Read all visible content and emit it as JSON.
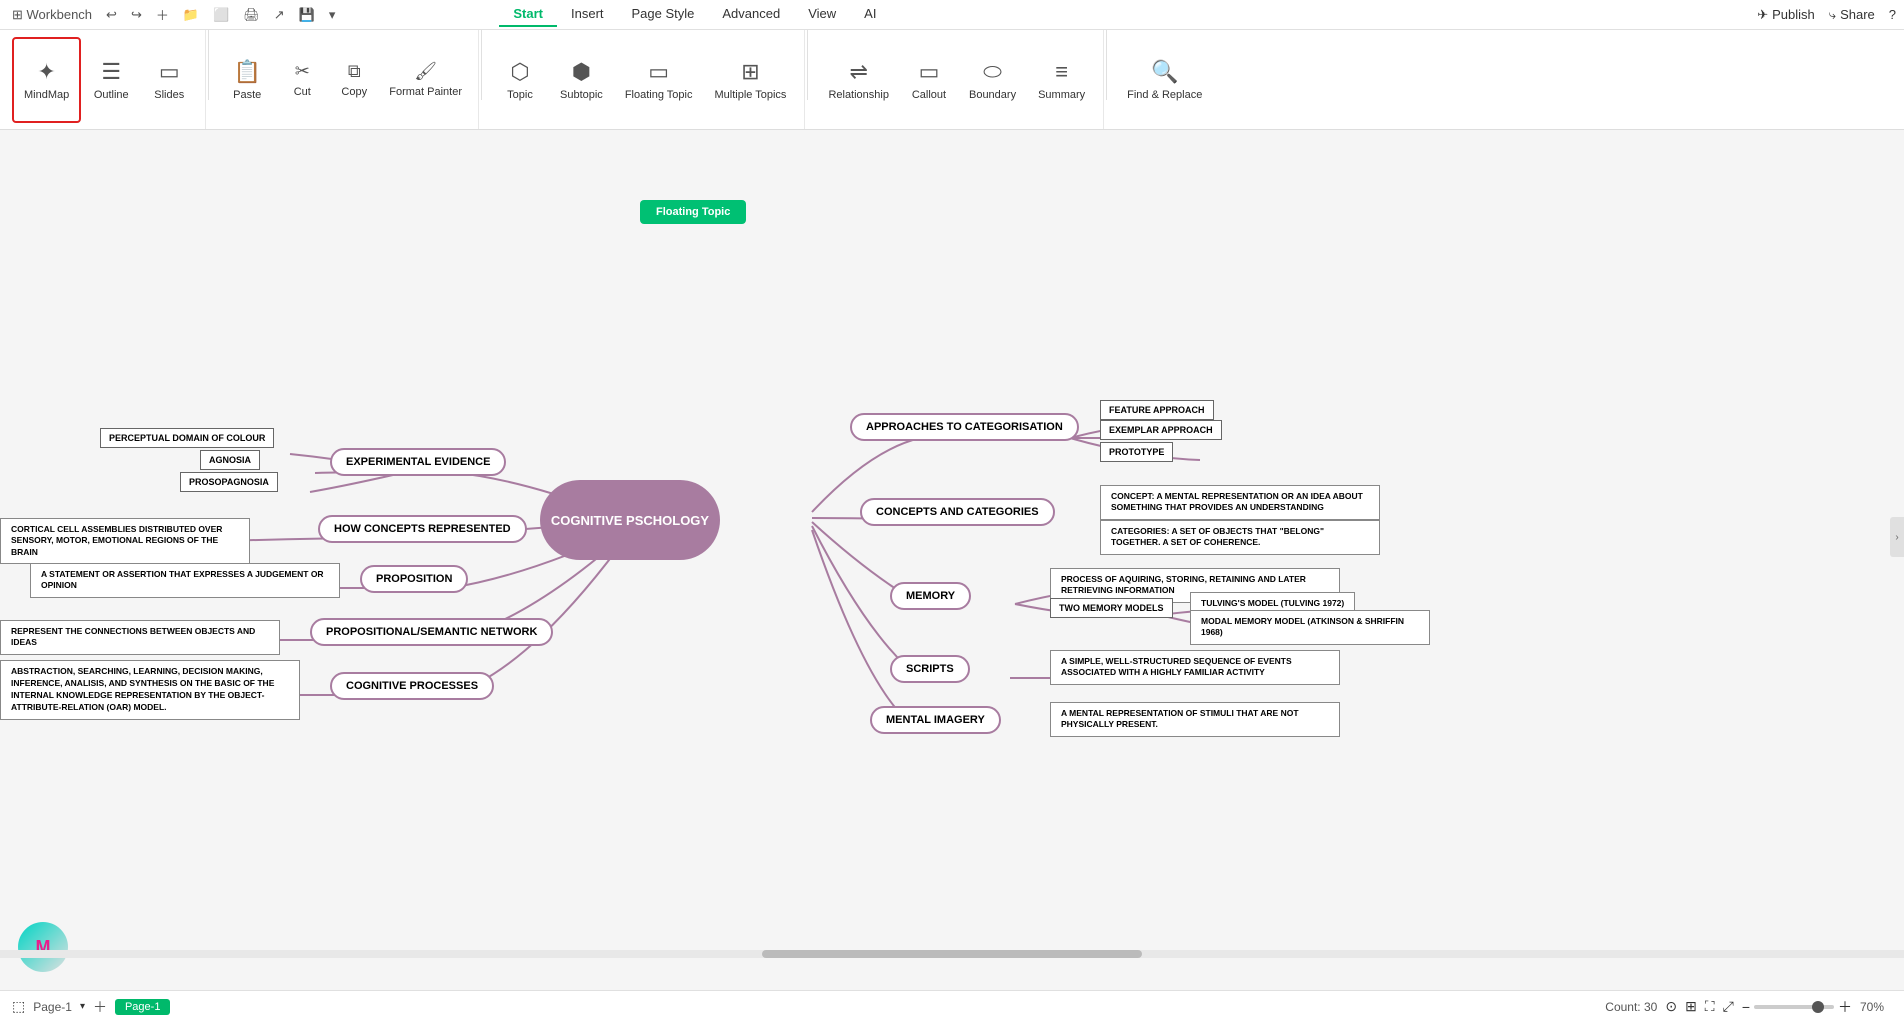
{
  "app": {
    "workbench_label": "Workbench",
    "logo_icon": "✦"
  },
  "nav_tabs": [
    {
      "label": "Start",
      "active": true
    },
    {
      "label": "Insert",
      "active": false
    },
    {
      "label": "Page Style",
      "active": false
    },
    {
      "label": "Advanced",
      "active": false
    },
    {
      "label": "View",
      "active": false
    },
    {
      "label": "AI",
      "active": false
    }
  ],
  "top_right": {
    "publish": "Publish",
    "share": "Share",
    "help": "?"
  },
  "ribbon": {
    "mindmap_label": "MindMap",
    "outline_label": "Outline",
    "slides_label": "Slides",
    "paste_label": "Paste",
    "cut_label": "Cut",
    "copy_label": "Copy",
    "format_painter_label": "Format Painter",
    "topic_label": "Topic",
    "subtopic_label": "Subtopic",
    "floating_topic_label": "Floating Topic",
    "multiple_topics_label": "Multiple Topics",
    "relationship_label": "Relationship",
    "callout_label": "Callout",
    "boundary_label": "Boundary",
    "summary_label": "Summary",
    "find_replace_label": "Find & Replace"
  },
  "canvas": {
    "floating_topic_btn": "Floating Topic",
    "central_node": "COGNITIVE PSCHOLOGY",
    "branches_left": [
      {
        "id": "exp_evidence",
        "label": "EXPERIMENTAL EVIDENCE",
        "children": [
          "PERCEPTUAL DOMAIN OF COLOUR",
          "AGNOSIA",
          "PROSOPAGNOSIA"
        ]
      },
      {
        "id": "how_concepts",
        "label": "HOW CONCEPTS REPRESENTED",
        "children": [
          "CORTICAL CELL ASSEMBLIES DISTRIBUTED OVER SENSORY, MOTOR, EMOTIONAL REGIONS OF THE BRAIN"
        ]
      },
      {
        "id": "proposition",
        "label": "PROPOSITION",
        "children": [
          "A STATEMENT OR ASSERTION THAT EXPRESSES A JUDGEMENT OR OPINION"
        ]
      },
      {
        "id": "prop_semantic",
        "label": "PROPOSITIONAL/SEMANTIC NETWORK",
        "children": [
          "REPRESENT THE CONNECTIONS BETWEEN OBJECTS AND IDEAS"
        ]
      },
      {
        "id": "cog_processes",
        "label": "COGNITIVE PROCESSES",
        "children": [
          "ABSTRACTION, SEARCHING, LEARNING, DECISION MAKING, INFERENCE, ANALISIS, AND SYNTHESIS ON THE BASIC OF THE INTERNAL KNOWLEDGE REPRESENTATION BY THE OBJECT-ATTRIBUTE-RELATION (OAR) MODEL."
        ]
      }
    ],
    "branches_right": [
      {
        "id": "approaches",
        "label": "APPROACHES TO CATEGORISATION",
        "children": [
          "FEATURE APPROACH",
          "EXEMPLAR APPROACH",
          "PROTOTYPE"
        ]
      },
      {
        "id": "concepts_cats",
        "label": "CONCEPTS AND CATEGORIES",
        "children": [
          "CONCEPT: A MENTAL REPRESENTATION OR AN IDEA ABOUT SOMETHING THAT PROVIDES AN UNDERSTANDING",
          "CATEGORIES: A SET OF OBJECTS THAT \"BELONG\" TOGETHER. A SET OF COHERENCE."
        ]
      },
      {
        "id": "memory",
        "label": "MEMORY",
        "children": [
          "PROCESS OF AQUIRING, STORING, RETAINING AND LATER RETRIEVING INFORMATION",
          "TWO MEMORY MODELS"
        ],
        "grandchildren": [
          "TULVING'S MODEL (TULVING 1972)",
          "MODAL MEMORY MODEL (ATKINSON & SHRIFFIN 1968)"
        ]
      },
      {
        "id": "scripts",
        "label": "SCRIPTS",
        "children": [
          "A SIMPLE, WELL-STRUCTURED SEQUENCE OF EVENTS ASSOCIATED WITH A HIGHLY FAMILIAR ACTIVITY"
        ]
      },
      {
        "id": "mental_imagery",
        "label": "MENTAL IMAGERY",
        "children": [
          "A MENTAL REPRESENTATION OF STIMULI THAT ARE NOT PHYSICALLY PRESENT."
        ]
      }
    ]
  },
  "status": {
    "page_indicator": "Page-1",
    "active_page_tab": "Page-1",
    "count": "Count: 30",
    "zoom": "70%"
  }
}
